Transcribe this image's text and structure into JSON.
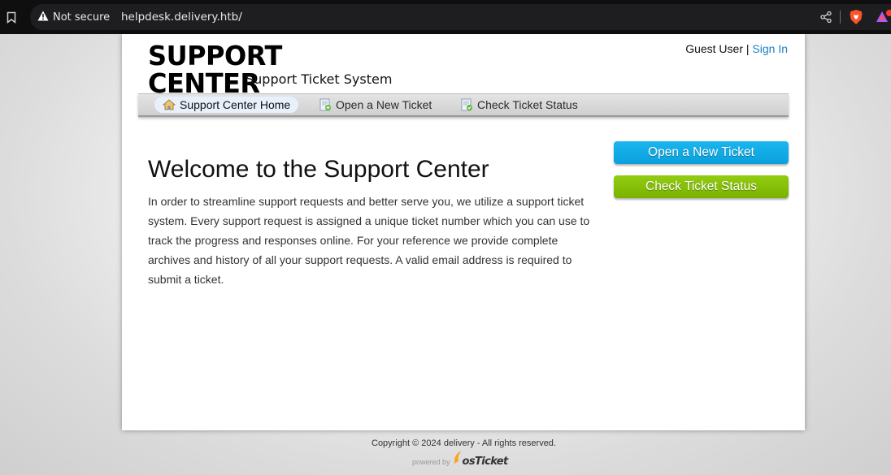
{
  "browser": {
    "security_label": "Not secure",
    "url": "helpdesk.delivery.htb/"
  },
  "header": {
    "logo_title": "SUPPORT CENTER",
    "logo_subtitle": "Support Ticket System",
    "guest_label": "Guest User |",
    "sign_in": "Sign In"
  },
  "nav": {
    "items": [
      {
        "label": "Support Center Home",
        "icon": "home-icon"
      },
      {
        "label": "Open a New Ticket",
        "icon": "new-ticket-icon"
      },
      {
        "label": "Check Ticket Status",
        "icon": "ticket-status-icon"
      }
    ]
  },
  "main": {
    "heading": "Welcome to the Support Center",
    "intro": "In order to streamline support requests and better serve you, we utilize a support ticket system. Every support request is assigned a unique ticket number which you can use to track the progress and responses online. For your reference we provide complete archives and history of all your support requests. A valid email address is required to submit a ticket."
  },
  "sidebar": {
    "open_ticket_btn": "Open a New Ticket",
    "check_status_btn": "Check Ticket Status"
  },
  "footer": {
    "copyright": "Copyright © 2024 delivery - All rights reserved.",
    "powered_by": "powered by",
    "brand": "osTicket"
  },
  "colors": {
    "link": "#1a82c4",
    "btn_blue": "#0aa0dc",
    "btn_green": "#79b300"
  }
}
